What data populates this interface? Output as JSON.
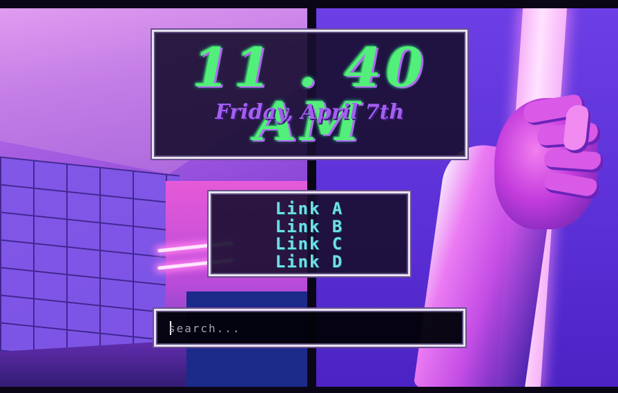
{
  "clock": {
    "time": "11 . 40 AM",
    "date": "Friday, April 7th"
  },
  "links": [
    {
      "label": "Link A"
    },
    {
      "label": "Link B"
    },
    {
      "label": "Link C"
    },
    {
      "label": "Link D"
    }
  ],
  "search": {
    "placeholder": "search...",
    "value": ""
  },
  "colors": {
    "clock_text": "#52f07a",
    "date_text": "#a45ff0",
    "link_text": "#6fe0e8",
    "panel_border": "#e9e4f2"
  }
}
